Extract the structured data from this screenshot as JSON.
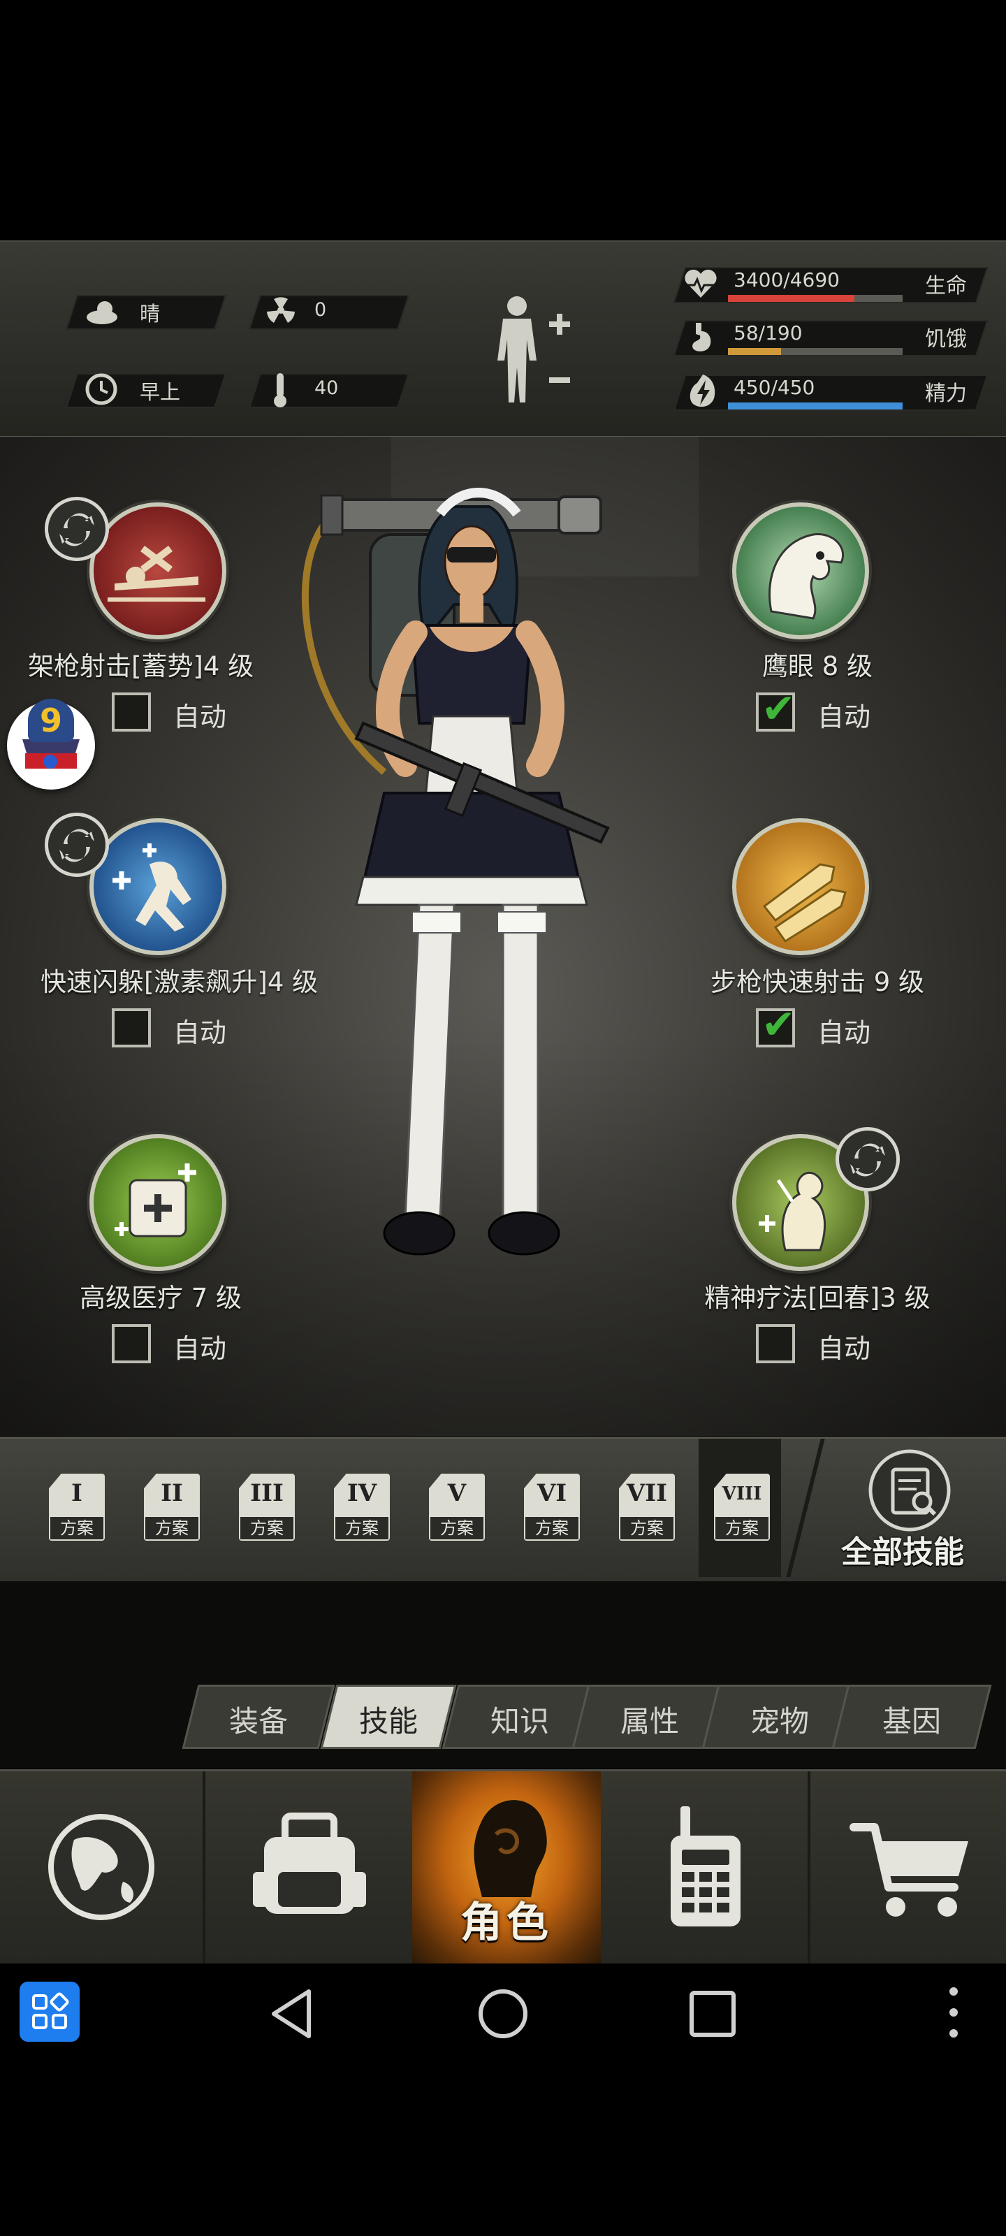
{
  "status": {
    "weather": "晴",
    "radiation": "0",
    "time_of_day": "早上",
    "temperature": "40",
    "health": {
      "value": "3400/4690",
      "label": "生命",
      "fraction": 0.725,
      "color": "#d8433a"
    },
    "hunger": {
      "value": "58/190",
      "label": "饥饿",
      "fraction": 0.305,
      "color": "#d09a3a"
    },
    "energy": {
      "value": "450/450",
      "label": "精力",
      "fraction": 1.0,
      "color": "#3f8fd8"
    }
  },
  "skills": [
    {
      "name": "架枪射击[蓄势]4 级",
      "auto_label": "自动",
      "auto": false,
      "swappable": true,
      "icon": "sniper-prone-icon"
    },
    {
      "name": "鹰眼 8 级",
      "auto_label": "自动",
      "auto": true,
      "swappable": false,
      "icon": "eagle-icon"
    },
    {
      "name": "快速闪躲[激素飙升]4 级",
      "auto_label": "自动",
      "auto": false,
      "swappable": true,
      "icon": "dodge-icon"
    },
    {
      "name": "步枪快速射击 9 级",
      "auto_label": "自动",
      "auto": true,
      "swappable": false,
      "icon": "bullets-icon"
    },
    {
      "name": "高级医疗 7 级",
      "auto_label": "自动",
      "auto": false,
      "swappable": false,
      "icon": "medkit-icon"
    },
    {
      "name": "精神疗法[回春]3 级",
      "auto_label": "自动",
      "auto": false,
      "swappable": true,
      "icon": "spirit-heal-icon"
    }
  ],
  "floating_badge": {
    "count": "9"
  },
  "plans": {
    "items": [
      {
        "numeral": "I",
        "label": "方案"
      },
      {
        "numeral": "II",
        "label": "方案"
      },
      {
        "numeral": "III",
        "label": "方案"
      },
      {
        "numeral": "IV",
        "label": "方案"
      },
      {
        "numeral": "V",
        "label": "方案"
      },
      {
        "numeral": "VI",
        "label": "方案"
      },
      {
        "numeral": "VII",
        "label": "方案"
      },
      {
        "numeral": "VIII",
        "label": "方案"
      }
    ],
    "selected_index": 7,
    "all_skills_label": "全部技能"
  },
  "tabs": {
    "items": [
      "装备",
      "技能",
      "知识",
      "属性",
      "宠物",
      "基因"
    ],
    "selected_index": 1
  },
  "nav": {
    "character_label": "角色"
  },
  "colors": {
    "check_green": "#3fb63a",
    "accent_orange": "#e88a1a"
  }
}
